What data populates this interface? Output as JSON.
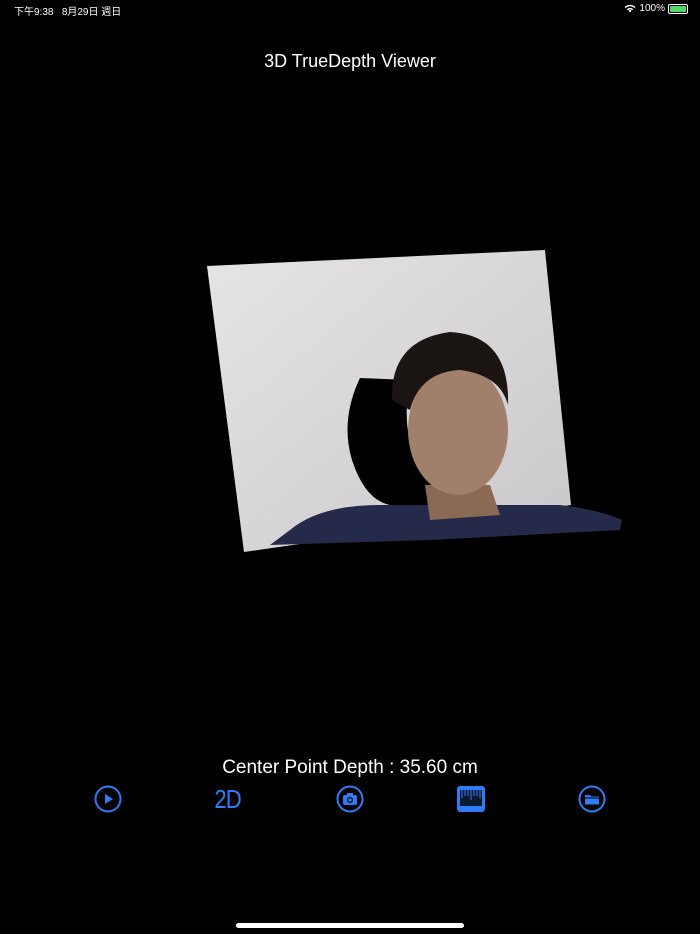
{
  "status_bar": {
    "time": "下午9:38",
    "date": "8月29日 週日",
    "battery": "100%"
  },
  "header": {
    "title": "3D TrueDepth Viewer"
  },
  "viewer": {
    "depth_label": "Center Point Depth : 35.60 cm"
  },
  "toolbar": {
    "play_icon": "play-circle-icon",
    "mode_label": "2D",
    "camera_icon": "camera-circle-icon",
    "ruler_icon": "ruler-icon",
    "folder_icon": "folder-circle-icon"
  },
  "colors": {
    "accent": "#2f7cf6",
    "background": "#000000"
  }
}
